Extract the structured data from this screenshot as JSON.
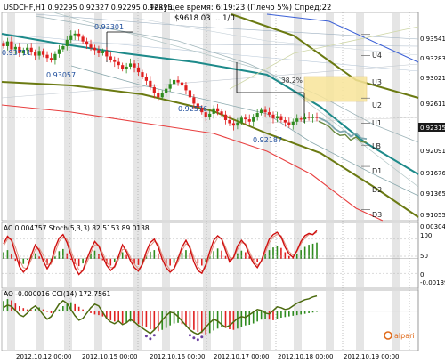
{
  "header": {
    "symbol_line": "USDCHF,H1  0.92295 0.92327 0.92295 0.92315",
    "server_time": "Текущее время: 6:19:23 (Плечо 5%) Спред:22",
    "price_info": "$9618.03 ... 1/0"
  },
  "main_price_labels": [
    "0.93541",
    "0.93283",
    "0.93021",
    "0.92611",
    "0.92315",
    "0.92091",
    "0.91676",
    "0.91365",
    "0.91055"
  ],
  "current_price": "0.92315",
  "level_labels": [
    "U4",
    "U3",
    "U2",
    "U1",
    "LB",
    "D1",
    "D2",
    "D3"
  ],
  "fib_label": "38.2%",
  "price_callouts": [
    "0.93711",
    "0.93057",
    "0.92576",
    "0.92187",
    "0.93301"
  ],
  "ac_panel": {
    "title": "AC 0.004757   Stoch(5,3,3) 82.5153 89.0138",
    "right_labels": [
      "0.00304",
      "100",
      "50",
      "0",
      "-0.00139"
    ]
  },
  "ao_panel": {
    "title": "AO -0.000016   CCI(14) 172.7561"
  },
  "x_labels": [
    "2012.10.12 00:00",
    "2012.10.15 00:00",
    "2012.10.16 00:00",
    "2012.10.17 00:00",
    "2012.10.18 00:00",
    "2012.10.19 00:00"
  ],
  "brand": "alpari",
  "colors": {
    "bull": "#2e8b1e",
    "bear": "#e02020",
    "teal_ma": "#1d8a8a",
    "olive_channel": "#6b7a12",
    "red_ma": "#e84040",
    "blue_line": "#3a5fd6",
    "fib_box": "#f8e59a",
    "stoch": "#d01010",
    "cci": "#4d6b10",
    "current_price_bg": "#1a1a1a"
  },
  "chart_data": {
    "type": "candlestick",
    "symbol": "USDCHF",
    "timeframe": "H1",
    "y_range": [
      0.91,
      0.9365
    ],
    "closes": [
      0.9322,
      0.9328,
      0.9318,
      0.9321,
      0.9313,
      0.9317,
      0.932,
      0.9314,
      0.931,
      0.9316,
      0.9311,
      0.9307,
      0.9305,
      0.9312,
      0.9318,
      0.9322,
      0.933,
      0.9336,
      0.9338,
      0.9334,
      0.9328,
      0.9324,
      0.932,
      0.9317,
      0.9313,
      0.9316,
      0.9309,
      0.9305,
      0.9302,
      0.9298,
      0.9293,
      0.9296,
      0.93,
      0.9295,
      0.9289,
      0.9283,
      0.9278,
      0.927,
      0.9262,
      0.9257,
      0.9263,
      0.9268,
      0.9274,
      0.9279,
      0.9276,
      0.9272,
      0.9266,
      0.9257,
      0.9249,
      0.9244,
      0.9238,
      0.9232,
      0.9236,
      0.9243,
      0.9239,
      0.9235,
      0.9228,
      0.9224,
      0.9221,
      0.9225,
      0.9231,
      0.9229,
      0.9226,
      0.9232,
      0.9237,
      0.9241,
      0.9238,
      0.9235,
      0.923,
      0.9233,
      0.9228,
      0.9225,
      0.9222,
      0.9226,
      0.923,
      0.9229,
      0.9232,
      0.9231,
      0.9232,
      0.9231
    ],
    "forecast": [
      0.9231,
      0.9228,
      0.9224,
      0.9217,
      0.9213,
      0.9214,
      0.9207,
      0.9211,
      0.9205,
      0.9204
    ],
    "levels": {
      "U4": 0.9337,
      "U3": 0.931,
      "U2": 0.9283,
      "U1": 0.9256,
      "LB": 0.9224,
      "D1": 0.9196,
      "D2": 0.9169,
      "D3": 0.9114
    },
    "stoch_k": [
      72,
      85,
      78,
      55,
      32,
      22,
      30,
      52,
      70,
      60,
      42,
      28,
      40,
      65,
      82,
      88,
      74,
      52,
      30,
      18,
      25,
      45,
      62,
      76,
      68,
      50,
      34,
      25,
      32,
      50,
      70,
      58,
      42,
      30,
      24,
      36,
      58,
      74,
      80,
      66,
      45,
      30,
      22,
      28,
      46,
      66,
      78,
      64,
      40,
      25,
      20,
      35,
      58,
      78,
      86,
      80,
      60,
      40,
      48,
      68,
      78,
      70,
      52,
      38,
      30,
      42,
      62,
      80,
      88,
      92,
      84,
      66,
      54,
      48,
      60,
      76,
      86,
      90,
      88,
      95
    ],
    "stoch_d": [
      68,
      80,
      80,
      66,
      44,
      30,
      28,
      44,
      62,
      64,
      52,
      36,
      36,
      56,
      76,
      84,
      80,
      60,
      40,
      26,
      24,
      38,
      56,
      70,
      70,
      56,
      40,
      30,
      30,
      44,
      62,
      62,
      48,
      36,
      28,
      34,
      50,
      68,
      76,
      72,
      52,
      36,
      26,
      28,
      40,
      60,
      72,
      68,
      48,
      32,
      24,
      30,
      50,
      70,
      82,
      82,
      66,
      48,
      46,
      62,
      74,
      72,
      58,
      42,
      34,
      40,
      56,
      74,
      84,
      88,
      86,
      72,
      58,
      52,
      58,
      72,
      82,
      88,
      88,
      92
    ],
    "ac": [
      0.0012,
      0.0016,
      0.0008,
      -0.0004,
      -0.0012,
      -0.001,
      -0.0002,
      0.0006,
      0.001,
      0.0004,
      -0.0006,
      -0.0012,
      -0.0008,
      0.0004,
      0.0014,
      0.0018,
      0.001,
      -0.0002,
      -0.001,
      -0.0014,
      -0.0009,
      0.0002,
      0.001,
      0.0015,
      0.0009,
      -0.0003,
      -0.001,
      -0.0013,
      -0.0007,
      0.0004,
      0.0012,
      0.0007,
      -0.0003,
      -0.001,
      -0.0012,
      -0.0006,
      0.0006,
      0.0013,
      0.0016,
      0.001,
      -0.0002,
      -0.001,
      -0.0013,
      -0.0008,
      0.0003,
      0.0011,
      0.0016,
      0.0011,
      0.0,
      -0.0009,
      -0.0013,
      -0.0007,
      0.0005,
      0.0014,
      0.0019,
      0.0015,
      0.0005,
      -0.0004,
      0.0002,
      0.001,
      0.0015,
      0.0012,
      0.0004,
      -0.0003,
      -0.0006,
      0.0,
      0.0009,
      0.0016,
      0.0021,
      0.0024,
      0.002,
      0.0012,
      0.0005,
      0.0002,
      0.0008,
      0.0016,
      0.0022,
      0.0026,
      0.0028,
      0.003
    ],
    "ao": [
      0.0016,
      0.0019,
      0.0017,
      0.0012,
      0.0008,
      0.0005,
      0.0003,
      0.0002,
      0.0004,
      0.0006,
      0.0003,
      -0.0001,
      -0.0003,
      -0.0001,
      0.0003,
      0.0008,
      0.0012,
      0.0014,
      0.0011,
      0.0007,
      0.0003,
      0.0,
      -0.0003,
      -0.0005,
      -0.0006,
      -0.0008,
      -0.0011,
      -0.0014,
      -0.0016,
      -0.0017,
      -0.0019,
      -0.0018,
      -0.0016,
      -0.0018,
      -0.002,
      -0.0023,
      -0.0025,
      -0.0028,
      -0.003,
      -0.0031,
      -0.0029,
      -0.0026,
      -0.0022,
      -0.0019,
      -0.0018,
      -0.002,
      -0.0023,
      -0.0026,
      -0.0029,
      -0.0032,
      -0.0034,
      -0.0036,
      -0.0034,
      -0.003,
      -0.0027,
      -0.0025,
      -0.0026,
      -0.0028,
      -0.0029,
      -0.0027,
      -0.0024,
      -0.0022,
      -0.0021,
      -0.0019,
      -0.0016,
      -0.0013,
      -0.0012,
      -0.0013,
      -0.0014,
      -0.0012,
      -0.001,
      -0.0009,
      -0.0008,
      -0.0007,
      -0.0006,
      -0.0005,
      -0.0004,
      -0.0003,
      -0.0002,
      -0.0001
    ],
    "cci": [
      40,
      70,
      55,
      10,
      -40,
      -60,
      -20,
      30,
      60,
      20,
      -40,
      -90,
      -60,
      10,
      80,
      120,
      90,
      20,
      -50,
      -100,
      -80,
      -20,
      40,
      80,
      60,
      -10,
      -80,
      -120,
      -140,
      -110,
      -150,
      -130,
      -90,
      -120,
      -160,
      -190,
      -220,
      -250,
      -210,
      -160,
      -100,
      -50,
      -10,
      -20,
      -60,
      -110,
      -160,
      -210,
      -240,
      -260,
      -230,
      -180,
      -130,
      -90,
      -110,
      -150,
      -180,
      -160,
      -120,
      -80,
      -60,
      -70,
      -40,
      -10,
      20,
      10,
      -20,
      -30,
      10,
      50,
      40,
      20,
      30,
      60,
      90,
      110,
      130,
      140,
      160,
      172
    ]
  }
}
